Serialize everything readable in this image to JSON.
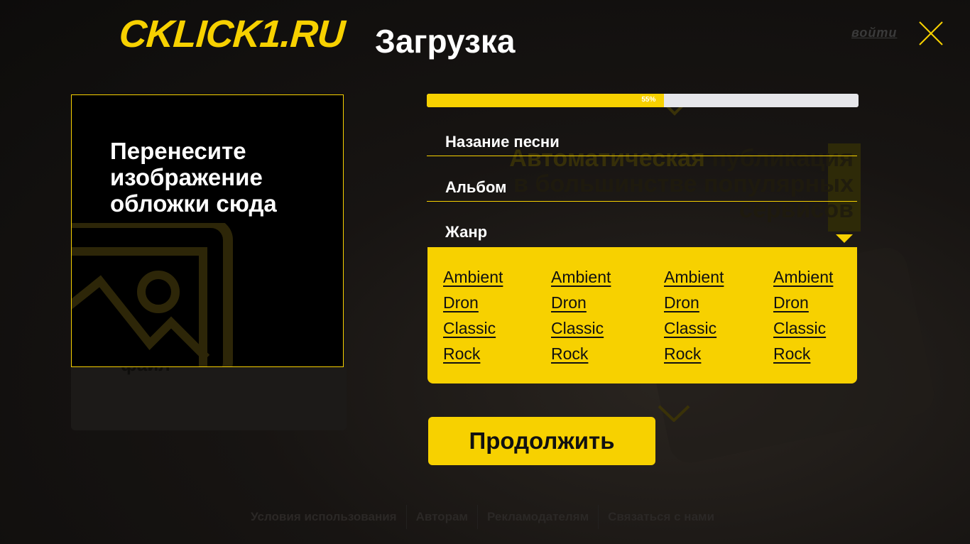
{
  "header": {
    "logo_text": "CKLICK1.RU",
    "title": "Загрузка",
    "login_label": "войти",
    "close_icon": "close-icon"
  },
  "background": {
    "line1_highlight": "Автоматическая",
    "line1_rest": "публикация",
    "line2": "в большинстве популярных",
    "line3": "сервисов",
    "card_word": "файл"
  },
  "dropzone": {
    "text": "Перенесите изображение обложки сюда",
    "icon": "image-icon"
  },
  "progress": {
    "percent": 55,
    "label": "55%"
  },
  "form": {
    "song_name_label": "Назание песни",
    "album_label": "Альбом",
    "genre_label": "Жанр"
  },
  "genres": {
    "columns": [
      [
        "Ambient",
        "Dron",
        "Classic",
        "Rock"
      ],
      [
        "Ambient",
        "Dron",
        "Classic",
        "Rock"
      ],
      [
        "Ambient",
        "Dron",
        "Classic",
        "Rock"
      ],
      [
        "Ambient",
        "Dron",
        "Classic",
        "Rock"
      ]
    ]
  },
  "continue_label": "Продолжить",
  "footer": {
    "terms": "Условия использования",
    "authors": "Авторам",
    "advertisers": "Рекламодателям",
    "contact": "Связаться с нами"
  },
  "colors": {
    "accent": "#f7d100",
    "background": "#171412",
    "progress_track": "#e6e6ea"
  }
}
